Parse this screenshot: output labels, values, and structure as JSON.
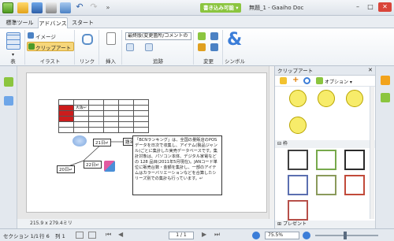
{
  "titlebar": {
    "writable": "書き込み可能",
    "doc_title": "無題_1 - Gaaiho Doc"
  },
  "tabs": [
    "標準ツール",
    "アドバンス",
    "スタート"
  ],
  "ribbon": {
    "groups": [
      {
        "label": "表"
      },
      {
        "label": "イラスト"
      },
      {
        "label": "リンク"
      },
      {
        "label": "挿入"
      },
      {
        "label": "追跡"
      },
      {
        "label": "変更"
      },
      {
        "label": "シンボル"
      }
    ],
    "image_label": "イメージ",
    "clipart_label": "クリップアート",
    "track_dropdown": "最終版(変更箇所/コメントの",
    "colors": {
      "accent": "#3b7dd8",
      "green": "#8bc53f"
    }
  },
  "document": {
    "status": "215.9 x 279.4ミリ",
    "table_rows": [
      [
        "",
        "",
        "",
        "",
        "",
        ""
      ],
      [
        "",
        "大阪↵",
        "",
        "",
        "",
        ""
      ],
      [
        "",
        "",
        "",
        "",
        "",
        ""
      ],
      [
        "",
        "",
        "",
        "",
        "",
        ""
      ],
      [
        "",
        "",
        "",
        "",
        "",
        ""
      ],
      [
        "",
        "",
        "",
        "",
        "",
        ""
      ]
    ],
    "diagram": {
      "box1": "21日↵",
      "box2": "22日↵",
      "box3": "20日↵",
      "label": "題名"
    },
    "paragraph": "「BCNランキング」は、全国の量販店のPOSデータを日次で収集し、アイテム(製品ジャンル)ごとに集計した実売データベースです。集計対象は、パソコン本体、デジタル家電などの 128 品目(2011年5月現在)。JANコード単位に販売台数・金額を集計し、一部のアイテムはカラーバリエーションなどを合算したシリーズ別での集計も行っています。↵"
  },
  "clipart": {
    "title": "クリップアート",
    "options_label": "オプション",
    "section_label": "枠",
    "footer_label": "プレゼント"
  },
  "statusbar": {
    "section": "セクション 1/1",
    "row": "行 6",
    "col": "列 1",
    "page": "1 / 1",
    "zoom": "75.5%"
  }
}
